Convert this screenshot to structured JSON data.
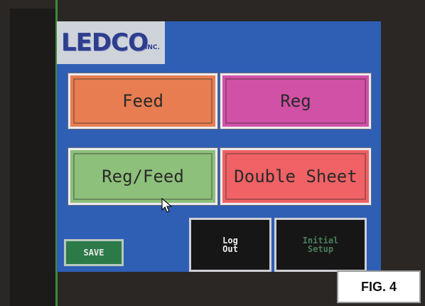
{
  "logo": {
    "brand": "LEDCO",
    "suffix": "INC."
  },
  "buttons": {
    "feed": "Feed",
    "reg": "Reg",
    "reg_feed": "Reg/Feed",
    "double_sheet": "Double Sheet",
    "log_out": "Log\nOut",
    "initial_setup": "Initial\nSetup",
    "save": "SAVE"
  },
  "figure_label": "FIG. 4",
  "colors": {
    "screen_bg": "#2f5fb4",
    "feed": "#e77d50",
    "reg": "#d151a6",
    "reg_feed": "#8dc07a",
    "double_sheet": "#f06265",
    "save": "#2c7a48"
  },
  "icons": {
    "pointer": "mouse-pointer-icon"
  }
}
